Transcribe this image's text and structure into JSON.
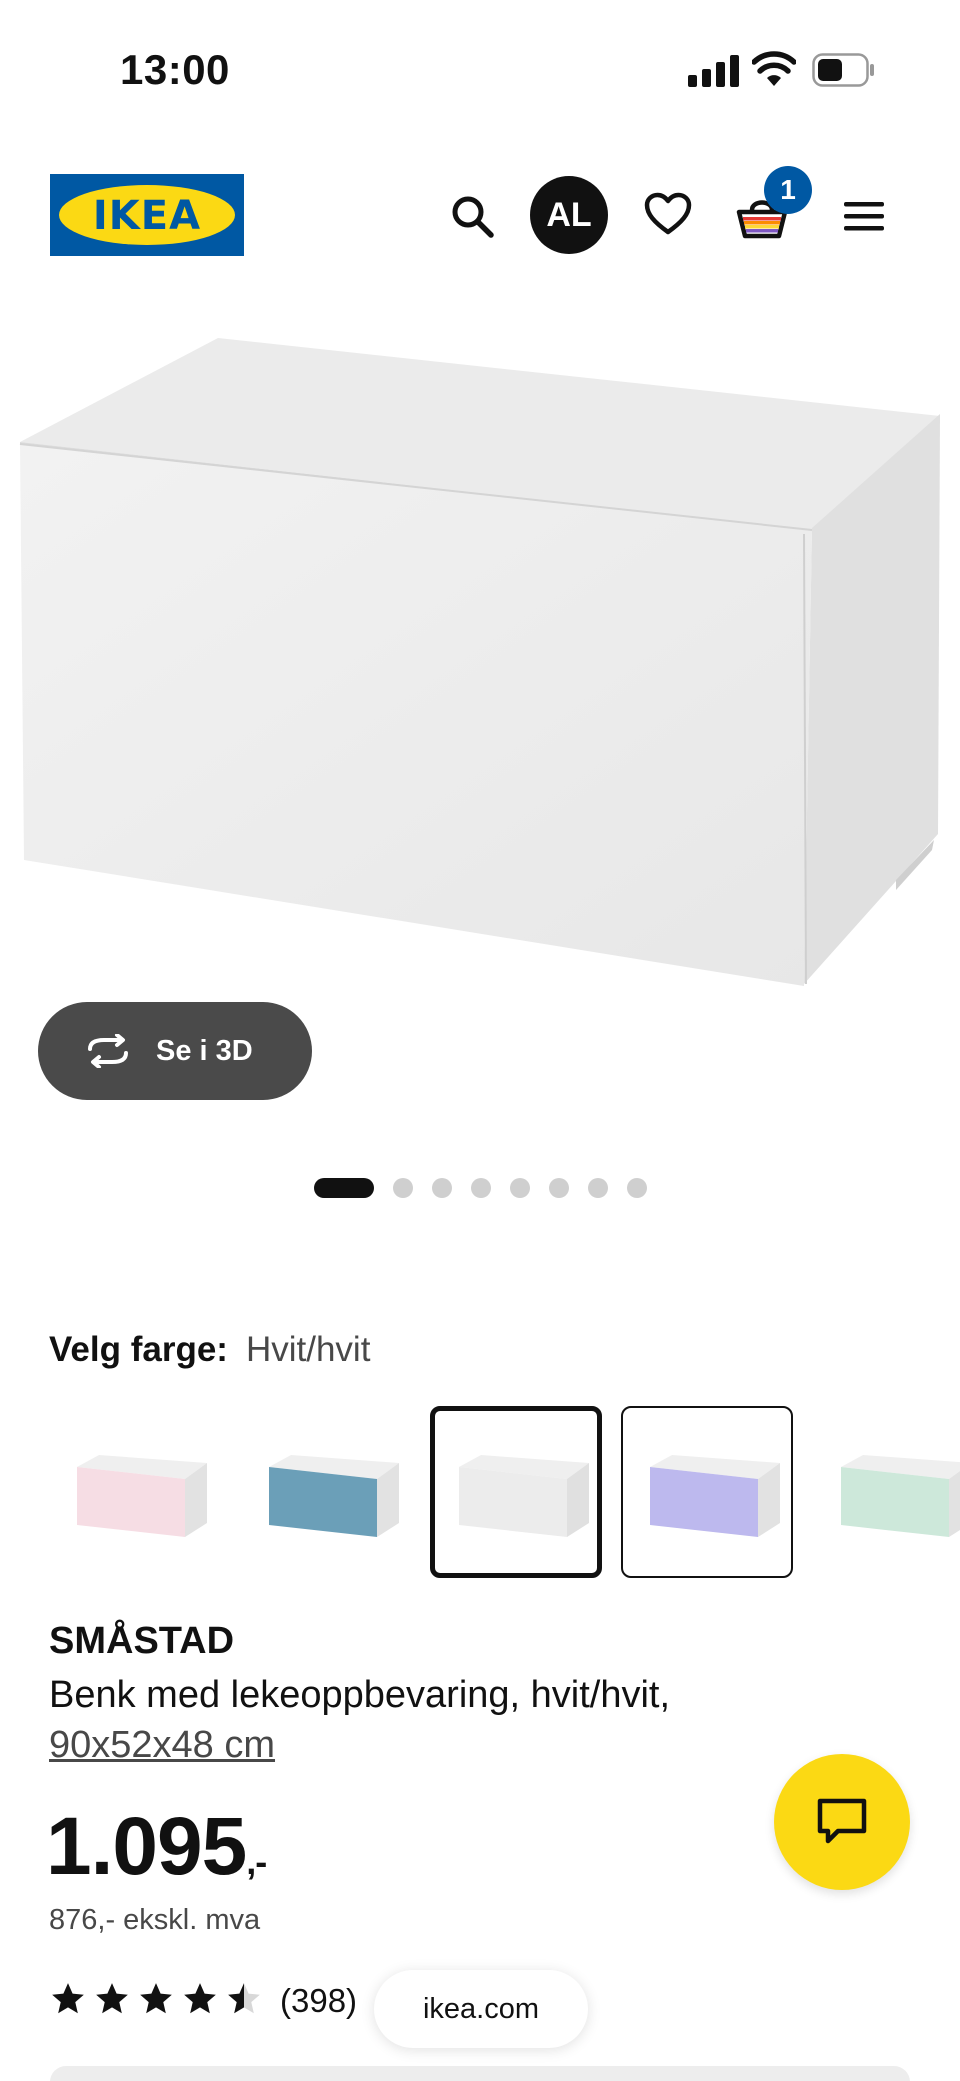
{
  "status_bar": {
    "time": "13:00",
    "signal_icon": "cellular-signal-icon",
    "wifi_icon": "wifi-icon",
    "battery_icon": "battery-icon"
  },
  "header": {
    "logo_text": "IKEA",
    "logo_colors": {
      "blue": "#0058a3",
      "yellow": "#fbd914"
    },
    "search_icon": "search-icon",
    "avatar_initials": "AL",
    "wishlist_icon": "heart-icon",
    "cart_icon": "shopping-basket-icon",
    "cart_count": "1",
    "menu_icon": "hamburger-menu-icon"
  },
  "gallery": {
    "view_3d_label": "Se i 3D",
    "view_3d_icon": "rotate-3d-icon",
    "total_images": 8,
    "active_index": 0
  },
  "colour_picker": {
    "label": "Velg farge:",
    "selected_value": "Hvit/hvit",
    "swatches": [
      {
        "name": "pink-front",
        "front_color": "#f6dde4"
      },
      {
        "name": "blue-front",
        "front_color": "#6b9fb8"
      },
      {
        "name": "white-front",
        "front_color": "#ececec",
        "selected": true
      },
      {
        "name": "lilac-front",
        "front_color": "#bdb9ee"
      },
      {
        "name": "mint-front",
        "front_color": "#cde8da"
      }
    ]
  },
  "product": {
    "name": "SMÅSTAD",
    "description": "Benk med lekeoppbevaring, hvit/hvit,",
    "dimensions": "90x52x48 cm",
    "price": "1.095",
    "price_suffix": ",-",
    "price_ex_vat": "876,- ekskl. mva",
    "rating_value": 4.5,
    "rating_max": 5,
    "review_count": "(398)"
  },
  "chat": {
    "icon": "chat-bubble-icon",
    "color": "#fbd914"
  },
  "browser": {
    "url": "ikea.com"
  }
}
